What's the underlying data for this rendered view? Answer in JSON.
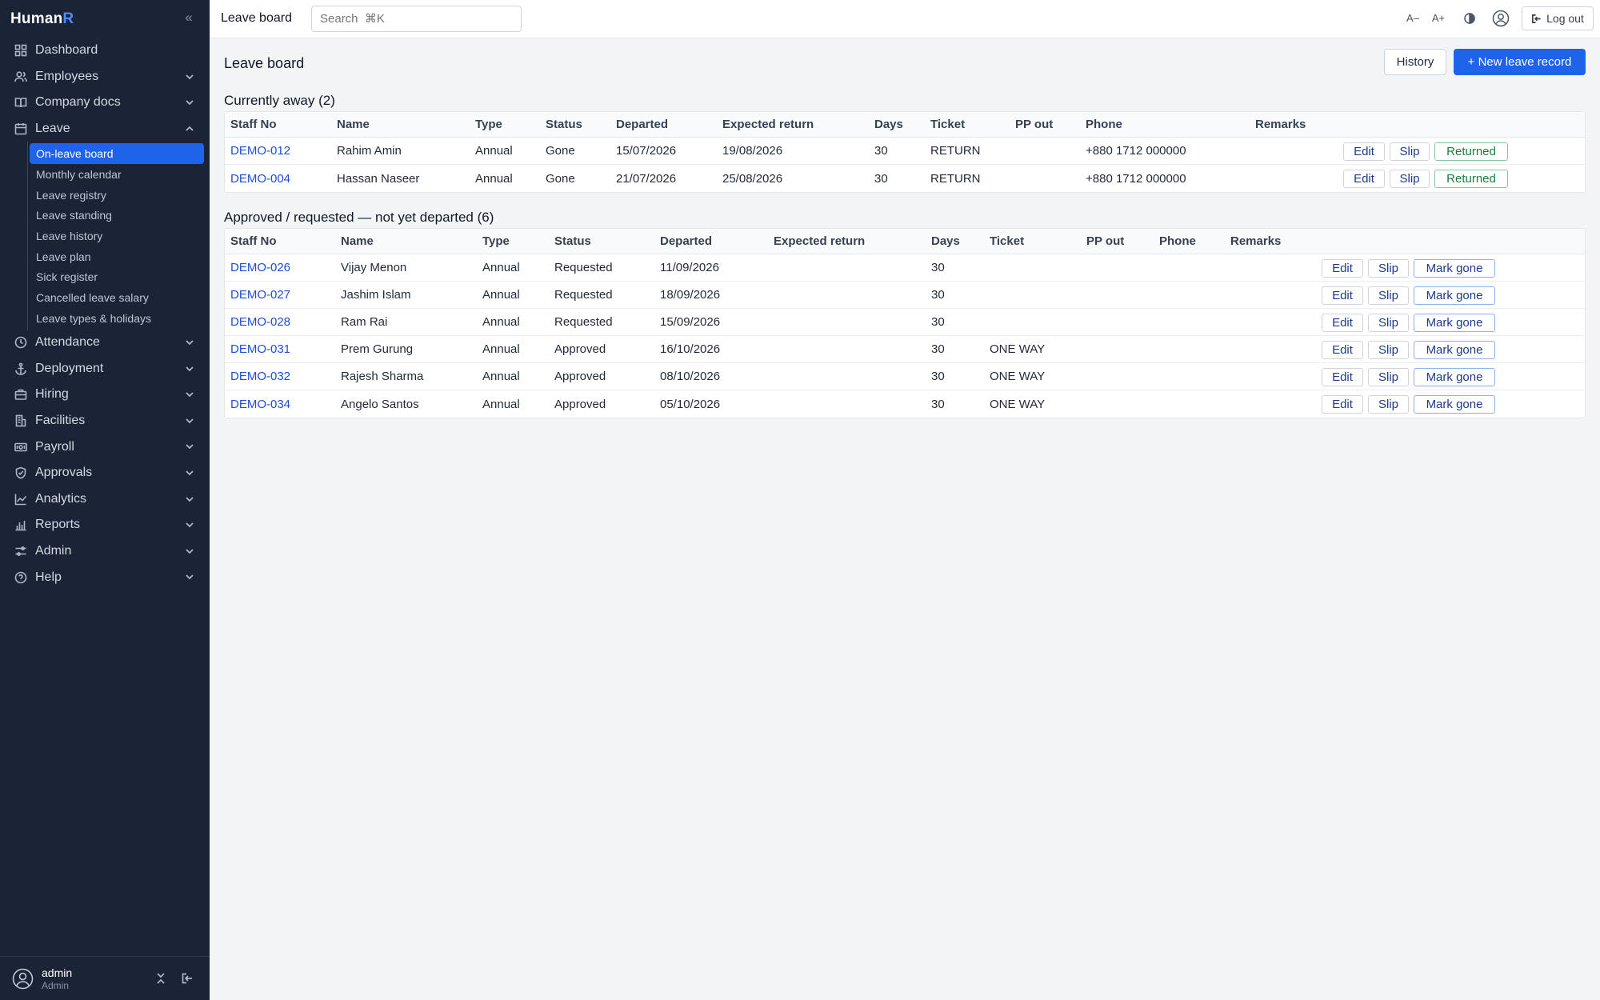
{
  "brand": {
    "prefix": "Human",
    "accent": "R"
  },
  "sidebar": {
    "top_items": [
      {
        "label": "Dashboard",
        "icon": "dashboard-icon"
      },
      {
        "label": "Employees",
        "icon": "users-icon"
      },
      {
        "label": "Company docs",
        "icon": "book-icon"
      },
      {
        "label": "Leave",
        "icon": "calendar-icon"
      }
    ],
    "leave_sub": [
      {
        "label": "On-leave board",
        "active": true
      },
      {
        "label": "Monthly calendar"
      },
      {
        "label": "Leave registry"
      },
      {
        "label": "Leave standing"
      },
      {
        "label": "Leave history"
      },
      {
        "label": "Leave plan"
      },
      {
        "label": "Sick register"
      },
      {
        "label": "Cancelled leave salary"
      },
      {
        "label": "Leave types & holidays"
      }
    ],
    "lower_items": [
      {
        "label": "Attendance",
        "icon": "clock-icon"
      },
      {
        "label": "Deployment",
        "icon": "anchor-icon"
      },
      {
        "label": "Hiring",
        "icon": "briefcase-icon"
      },
      {
        "label": "Facilities",
        "icon": "building-icon"
      },
      {
        "label": "Payroll",
        "icon": "payroll-icon"
      },
      {
        "label": "Approvals",
        "icon": "shield-check-icon"
      },
      {
        "label": "Analytics",
        "icon": "chart-line-icon"
      },
      {
        "label": "Reports",
        "icon": "bar-chart-icon"
      },
      {
        "label": "Admin",
        "icon": "sliders-icon"
      },
      {
        "label": "Help",
        "icon": "help-icon"
      }
    ],
    "user": {
      "name": "admin",
      "role": "Admin"
    }
  },
  "topbar": {
    "title": "Leave board",
    "search_placeholder": "Search  ⌘K",
    "font_smaller": "A–",
    "font_larger": "A+",
    "logout_label": "Log out"
  },
  "main": {
    "title": "Leave board",
    "history_label": "History",
    "new_label": "+ New leave record",
    "away": {
      "title": "Currently away (2)",
      "headers": [
        "Staff No",
        "Name",
        "Type",
        "Status",
        "Departed",
        "Expected return",
        "Days",
        "Ticket",
        "PP out",
        "Phone",
        "Remarks"
      ],
      "rows": [
        {
          "staff": "DEMO-012",
          "name": "Rahim Amin",
          "type": "Annual",
          "status": "Gone",
          "departed": "15/07/2026",
          "ret": "19/08/2026",
          "days": "30",
          "ticket": "RETURN",
          "pp": "",
          "phone": "+880 1712 000000",
          "remarks": ""
        },
        {
          "staff": "DEMO-004",
          "name": "Hassan Naseer",
          "type": "Annual",
          "status": "Gone",
          "departed": "21/07/2026",
          "ret": "25/08/2026",
          "days": "30",
          "ticket": "RETURN",
          "pp": "",
          "phone": "+880 1712 000000",
          "remarks": ""
        }
      ],
      "actions": {
        "edit": "Edit",
        "slip": "Slip",
        "returned": "Returned"
      }
    },
    "pending": {
      "title": "Approved / requested — not yet departed (6)",
      "headers": [
        "Staff No",
        "Name",
        "Type",
        "Status",
        "Departed",
        "Expected return",
        "Days",
        "Ticket",
        "PP out",
        "Phone",
        "Remarks"
      ],
      "rows": [
        {
          "staff": "DEMO-026",
          "name": "Vijay Menon",
          "type": "Annual",
          "status": "Requested",
          "departed": "11/09/2026",
          "ret": "",
          "days": "30",
          "ticket": "",
          "pp": "",
          "phone": "",
          "remarks": ""
        },
        {
          "staff": "DEMO-027",
          "name": "Jashim Islam",
          "type": "Annual",
          "status": "Requested",
          "departed": "18/09/2026",
          "ret": "",
          "days": "30",
          "ticket": "",
          "pp": "",
          "phone": "",
          "remarks": ""
        },
        {
          "staff": "DEMO-028",
          "name": "Ram Rai",
          "type": "Annual",
          "status": "Requested",
          "departed": "15/09/2026",
          "ret": "",
          "days": "30",
          "ticket": "",
          "pp": "",
          "phone": "",
          "remarks": ""
        },
        {
          "staff": "DEMO-031",
          "name": "Prem Gurung",
          "type": "Annual",
          "status": "Approved",
          "departed": "16/10/2026",
          "ret": "",
          "days": "30",
          "ticket": "ONE WAY",
          "pp": "",
          "phone": "",
          "remarks": ""
        },
        {
          "staff": "DEMO-032",
          "name": "Rajesh Sharma",
          "type": "Annual",
          "status": "Approved",
          "departed": "08/10/2026",
          "ret": "",
          "days": "30",
          "ticket": "ONE WAY",
          "pp": "",
          "phone": "",
          "remarks": ""
        },
        {
          "staff": "DEMO-034",
          "name": "Angelo Santos",
          "type": "Annual",
          "status": "Approved",
          "departed": "05/10/2026",
          "ret": "",
          "days": "30",
          "ticket": "ONE WAY",
          "pp": "",
          "phone": "",
          "remarks": ""
        }
      ],
      "actions": {
        "edit": "Edit",
        "slip": "Slip",
        "gone": "Mark gone"
      }
    }
  },
  "colors": {
    "sidebar_bg": "#1b2337",
    "accent": "#1e63e9",
    "link": "#1d4ed8",
    "returned": "#15803d"
  }
}
